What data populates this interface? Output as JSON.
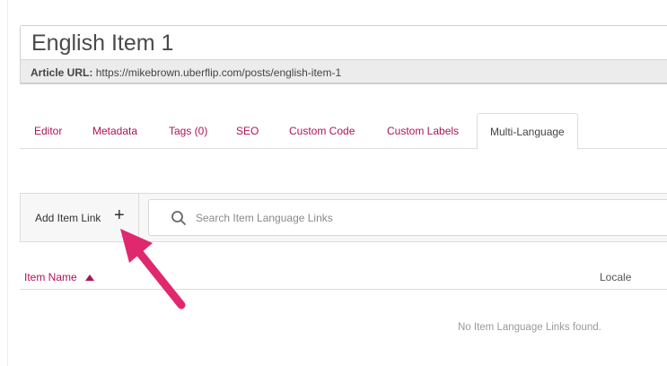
{
  "article": {
    "title": "English Item 1",
    "url_label": "Article URL:",
    "url_value": "https://mikebrown.uberflip.com/posts/english-item-1"
  },
  "tabs": [
    {
      "label": "Editor",
      "active": false
    },
    {
      "label": "Metadata",
      "active": false
    },
    {
      "label": "Tags (0)",
      "active": false
    },
    {
      "label": "SEO",
      "active": false
    },
    {
      "label": "Custom Code",
      "active": false
    },
    {
      "label": "Custom Labels",
      "active": false
    },
    {
      "label": "Multi-Language",
      "active": true
    }
  ],
  "toolbar": {
    "add_label": "Add Item Link",
    "add_icon": "plus-icon",
    "search_placeholder": "Search Item Language Links",
    "search_icon": "search-icon"
  },
  "table": {
    "columns": [
      "Item Name",
      "Locale"
    ],
    "sort_column": "Item Name",
    "sort_direction": "ascending",
    "empty_message": "No Item Language Links found."
  },
  "colors": {
    "accent": "#b0125b",
    "annotation_arrow": "#e0286e"
  }
}
